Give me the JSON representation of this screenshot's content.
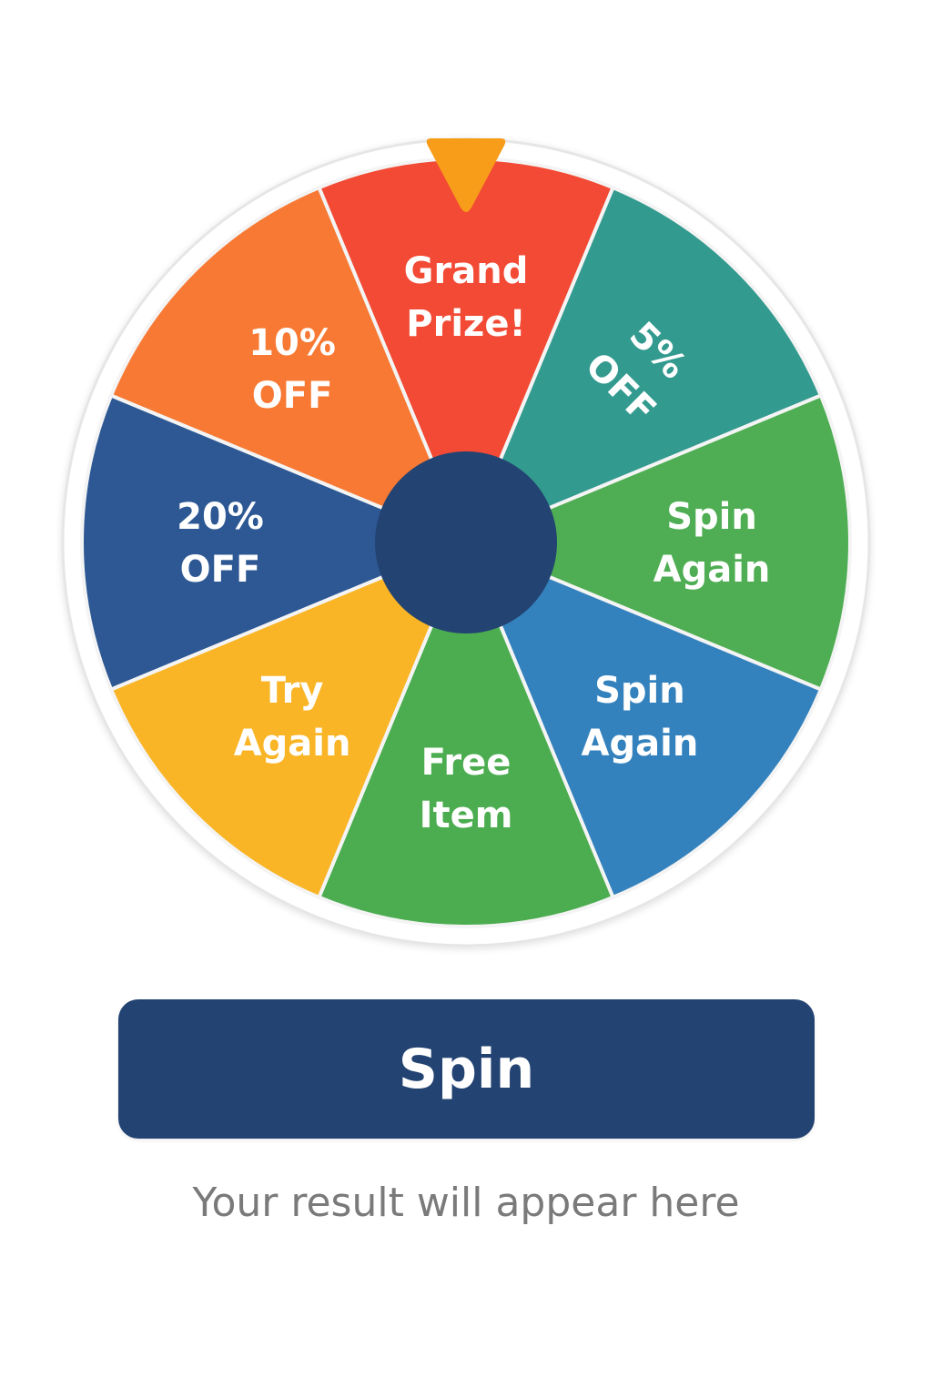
{
  "wheel": {
    "segments": [
      {
        "label_lines": [
          "Grand",
          "Prize!"
        ],
        "color": "#F24A34"
      },
      {
        "label_lines": [
          "5%",
          "OFF"
        ],
        "color": "#339A8F"
      },
      {
        "label_lines": [
          "Spin",
          "Again"
        ],
        "color": "#4FAE53"
      },
      {
        "label_lines": [
          "Spin",
          "Again"
        ],
        "color": "#3482BD"
      },
      {
        "label_lines": [
          "Free",
          "Item"
        ],
        "color": "#4CAD50"
      },
      {
        "label_lines": [
          "Try",
          "Again"
        ],
        "color": "#F9B526"
      },
      {
        "label_lines": [
          "20%",
          "OFF"
        ],
        "color": "#2D5894"
      },
      {
        "label_lines": [
          "10%",
          "OFF"
        ],
        "color": "#F77933"
      }
    ],
    "hub_color": "#234372",
    "pointer_color": "#F89D1A",
    "rim_color": "#ffffff"
  },
  "spin_button": {
    "label": "Spin"
  },
  "result": {
    "text": "Your result will appear here"
  },
  "colors": {
    "accent": "#234372",
    "muted_text": "#7a7a7a"
  }
}
